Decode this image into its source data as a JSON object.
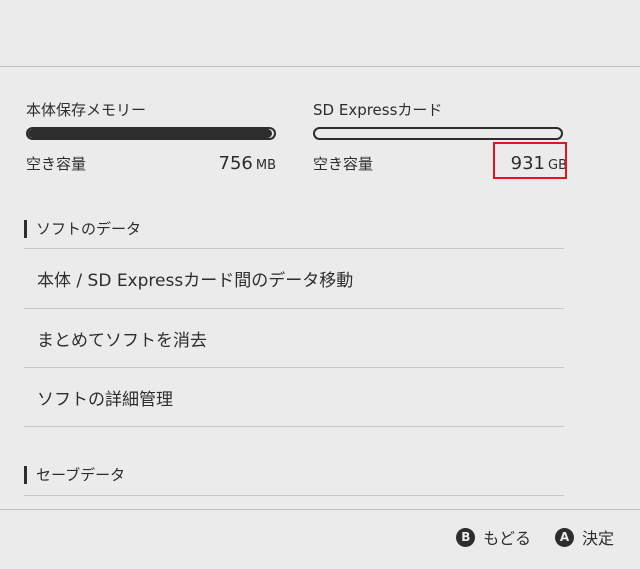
{
  "storage": {
    "internal": {
      "title": "本体保存メモリー",
      "free_label": "空き容量",
      "free_value": "756",
      "free_unit": "MB",
      "used_fraction": 0.99
    },
    "sd": {
      "title": "SD Expressカード",
      "free_label": "空き容量",
      "free_value": "931",
      "free_unit": "GB",
      "used_fraction": 0.0
    }
  },
  "sections": {
    "software": {
      "header": "ソフトのデータ",
      "items": [
        {
          "label": "本体 / SD Expressカード間のデータ移動"
        },
        {
          "label": "まとめてソフトを消去"
        },
        {
          "label": "ソフトの詳細管理"
        }
      ]
    },
    "save": {
      "header": "セーブデータ"
    }
  },
  "footer": {
    "back": {
      "glyph": "B",
      "label": "もどる"
    },
    "ok": {
      "glyph": "A",
      "label": "決定"
    }
  },
  "colors": {
    "background": "#ebebeb",
    "text": "#2d2d2d",
    "highlight": "#e4141c"
  }
}
